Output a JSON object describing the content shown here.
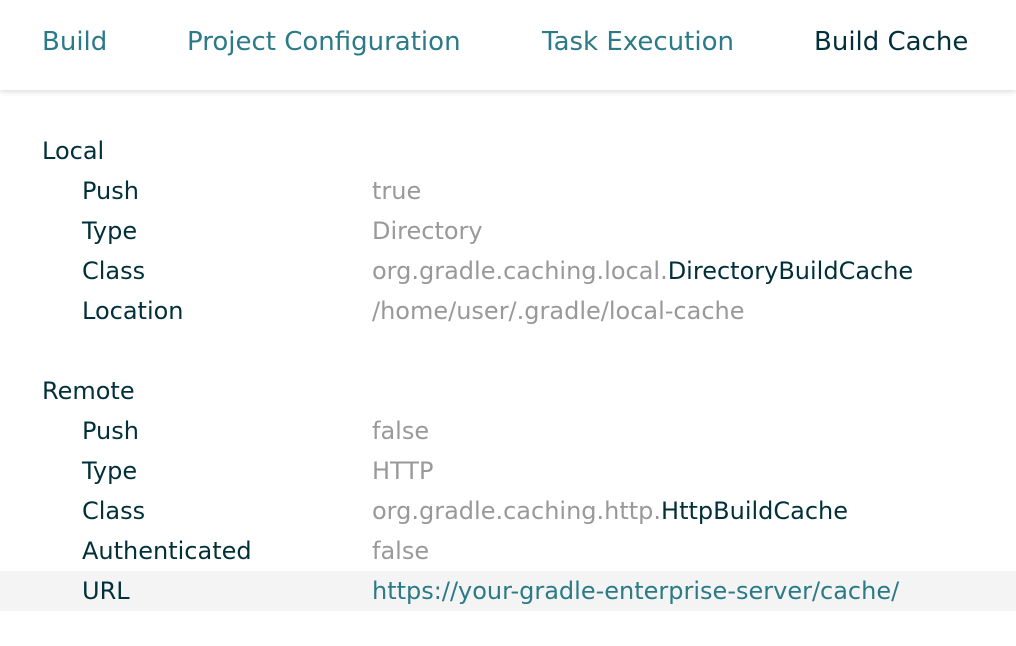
{
  "nav": {
    "tabs": [
      {
        "label": "Build"
      },
      {
        "label": "Project Configuration"
      },
      {
        "label": "Task Execution"
      },
      {
        "label": "Build Cache"
      }
    ],
    "active_tab": "Build Cache"
  },
  "local": {
    "title": "Local",
    "push_label": "Push",
    "push_value": "true",
    "type_label": "Type",
    "type_value": "Directory",
    "class_label": "Class",
    "class_package": "org.gradle.caching.local.",
    "class_name": "DirectoryBuildCache",
    "location_label": "Location",
    "location_value": "/home/user/.gradle/local-cache"
  },
  "remote": {
    "title": "Remote",
    "push_label": "Push",
    "push_value": "false",
    "type_label": "Type",
    "type_value": "HTTP",
    "class_label": "Class",
    "class_package": "org.gradle.caching.http.",
    "class_name": "HttpBuildCache",
    "auth_label": "Authenticated",
    "auth_value": "false",
    "url_label": "URL",
    "url_value": "https://your-gradle-enterprise-server/cache/"
  },
  "colors": {
    "link": "#2b7a87",
    "text_dark": "#02303a",
    "text_muted": "#999999",
    "row_highlight": "#f4f4f4"
  }
}
